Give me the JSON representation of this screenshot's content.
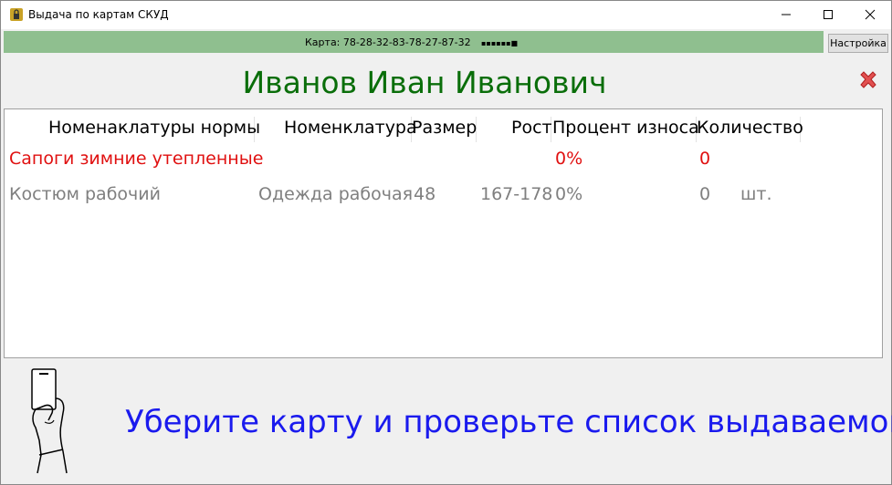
{
  "window": {
    "title": "Выдача по картам СКУД"
  },
  "status": {
    "card_label": "Карта: 78-28-32-83-78-27-87-32",
    "card_mask": "▪▪▪▪▪▪■"
  },
  "toolbar": {
    "settings_label": "Настройка"
  },
  "employee": {
    "name": "Иванов Иван Иванович"
  },
  "table": {
    "headers": [
      "Номенаклатуры нормы",
      "Номенклатура",
      "Размер",
      "Рост",
      "Процент износа",
      "Количество"
    ],
    "rows": [
      {
        "norm": "Сапоги зимние утепленные",
        "nomenclature": "",
        "size": "",
        "height": "",
        "wear": "0%",
        "quantity": "0",
        "unit": "",
        "color": "#e01010"
      },
      {
        "norm": "Костюм рабочий",
        "nomenclature": "Одежда рабочая",
        "size": "48",
        "height": "167-178",
        "wear": "0%",
        "quantity": "0",
        "unit": "шт.",
        "color": "#7f7f7f"
      }
    ]
  },
  "instruction": {
    "text": "Уберите карту и проверьте список выдаваемого"
  },
  "colors": {
    "status_bar": "#8fbf8f",
    "employee_name": "#0a6e0a",
    "instruction": "#1a1aee",
    "row_alert": "#e01010",
    "row_normal": "#7f7f7f"
  },
  "icons": [
    "app-lock-icon",
    "minimize-icon",
    "maximize-icon",
    "close-icon",
    "close-x-icon",
    "hand-card-icon"
  ]
}
